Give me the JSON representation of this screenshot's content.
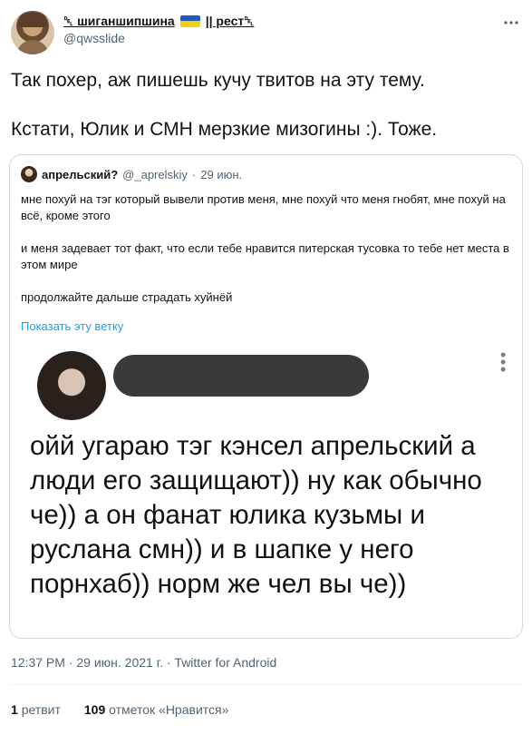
{
  "author": {
    "name_prefix": "␡ шиганшипшина",
    "name_suffix": "|| рест␡",
    "handle": "@qwsslide"
  },
  "tweet": {
    "line1": "Так похер, аж пишешь кучу твитов на эту тему.",
    "line2": "Кстати, Юлик и СМН мерзкие мизогины :). Тоже."
  },
  "quote": {
    "name": "апрельский?",
    "handle": "@_aprelskiy",
    "sep": "·",
    "date": "29 июн.",
    "para1": "мне похуй на тэг который вывели против меня, мне похуй что меня гнобят, мне похуй на всё, кроме этого",
    "para2": "и меня задевает тот факт, что если тебе нравится питерская тусовка то тебе нет места в этом мире",
    "para3": "продолжайте дальше страдать хуйнёй",
    "show_thread": "Показать эту ветку",
    "image_text": "ойй угараю тэг кэнсел апрельский а люди его защищают)) ну как обычно че)) а он фанат юлика кузьмы и руслана смн)) и в шапке у него порнхаб)) норм же чел вы че))"
  },
  "meta": {
    "timestamp": "12:37 PM · 29 июн. 2021 г. · Twitter for Android"
  },
  "stats": {
    "retweets_count": "1",
    "retweets_label": "ретвит",
    "likes_count": "109",
    "likes_label": "отметок «Нравится»"
  },
  "colors": {
    "link": "#1d9bf0",
    "muted": "#536471",
    "border": "#cfd9de"
  }
}
